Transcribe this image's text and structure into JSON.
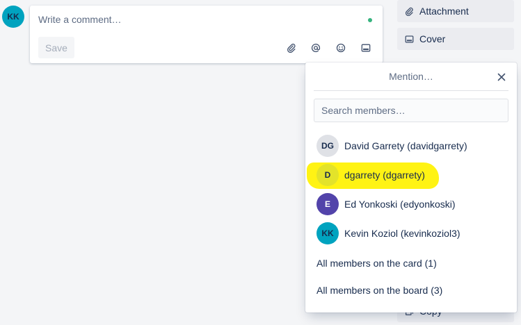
{
  "current_user": {
    "initials": "KK",
    "color": "#00a3bf"
  },
  "comment": {
    "placeholder": "Write a comment…",
    "save_label": "Save"
  },
  "toolbar": {
    "icons": [
      "paperclip-icon",
      "mention-icon",
      "emoji-icon",
      "card-icon"
    ]
  },
  "sidebar": {
    "attachment_label": "Attachment",
    "cover_label": "Cover",
    "copy_label": "Copy"
  },
  "mention": {
    "title": "Mention…",
    "search_placeholder": "Search members…",
    "members": [
      {
        "initials": "DG",
        "label": "David Garrety (davidgarrety)",
        "color": "#dfe1e6"
      },
      {
        "initials": "D",
        "label": "dgarrety (dgarrety)",
        "color": "#dfe1e6"
      },
      {
        "initials": "E",
        "label": "Ed Yonkoski (edyonkoski)",
        "color": "#5243aa"
      },
      {
        "initials": "KK",
        "label": "Kevin Koziol (kevinkoziol3)",
        "color": "#00a3bf"
      }
    ],
    "all_card_label": "All members on the card (1)",
    "all_board_label": "All members on the board (3)"
  },
  "colors": {
    "highlight": "#fff200",
    "status_dot": "#36b37e"
  }
}
